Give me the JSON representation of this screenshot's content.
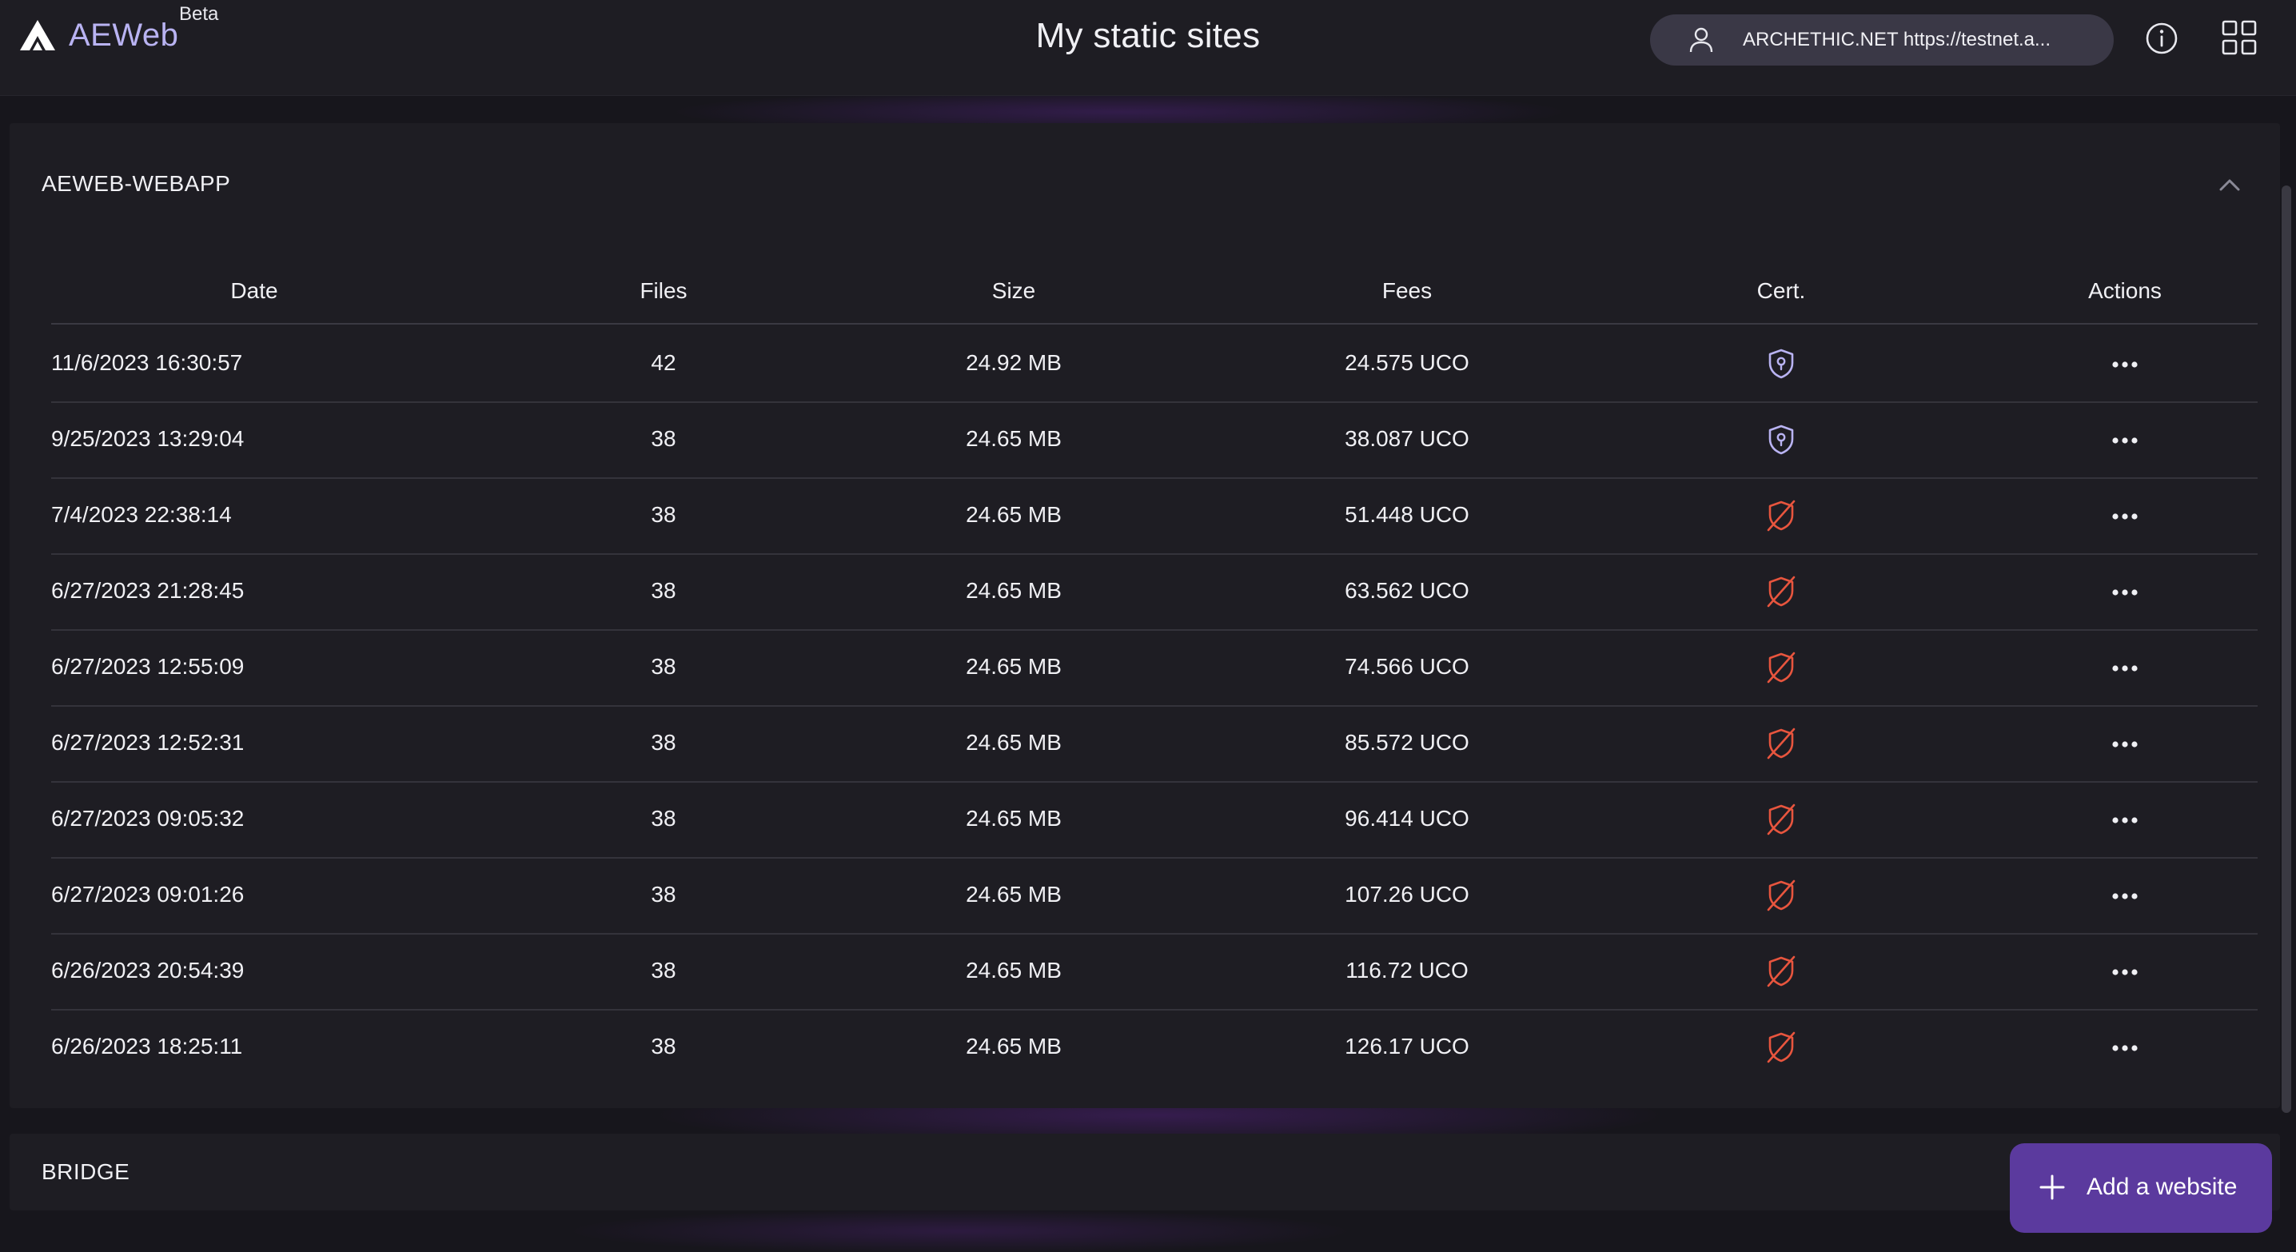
{
  "header": {
    "app_name": "AEWeb",
    "beta_label": "Beta",
    "title": "My static sites",
    "network_label": "ARCHETHIC.NET  https://testnet.a...",
    "icons": [
      "aeweb-logo-icon",
      "user-icon",
      "info-icon",
      "apps-grid-icon"
    ]
  },
  "sites": [
    {
      "name": "AEWEB-WEBAPP",
      "expanded": true,
      "columns": {
        "date": "Date",
        "files": "Files",
        "size": "Size",
        "fees": "Fees",
        "cert": "Cert.",
        "actions": "Actions"
      },
      "rows": [
        {
          "date": "11/6/2023 16:30:57",
          "files": "42",
          "size": "24.92 MB",
          "fees": "24.575 UCO",
          "cert": "certified"
        },
        {
          "date": "9/25/2023 13:29:04",
          "files": "38",
          "size": "24.65 MB",
          "fees": "38.087 UCO",
          "cert": "certified"
        },
        {
          "date": "7/4/2023 22:38:14",
          "files": "38",
          "size": "24.65 MB",
          "fees": "51.448 UCO",
          "cert": "none"
        },
        {
          "date": "6/27/2023 21:28:45",
          "files": "38",
          "size": "24.65 MB",
          "fees": "63.562 UCO",
          "cert": "none"
        },
        {
          "date": "6/27/2023 12:55:09",
          "files": "38",
          "size": "24.65 MB",
          "fees": "74.566 UCO",
          "cert": "none"
        },
        {
          "date": "6/27/2023 12:52:31",
          "files": "38",
          "size": "24.65 MB",
          "fees": "85.572 UCO",
          "cert": "none"
        },
        {
          "date": "6/27/2023 09:05:32",
          "files": "38",
          "size": "24.65 MB",
          "fees": "96.414 UCO",
          "cert": "none"
        },
        {
          "date": "6/27/2023 09:01:26",
          "files": "38",
          "size": "24.65 MB",
          "fees": "107.26 UCO",
          "cert": "none"
        },
        {
          "date": "6/26/2023 20:54:39",
          "files": "38",
          "size": "24.65 MB",
          "fees": "116.72 UCO",
          "cert": "none"
        },
        {
          "date": "6/26/2023 18:25:11",
          "files": "38",
          "size": "24.65 MB",
          "fees": "126.17 UCO",
          "cert": "none"
        }
      ]
    },
    {
      "name": "BRIDGE",
      "expanded": false
    }
  ],
  "add_button": {
    "label": "Add a website",
    "icon": "plus-icon"
  },
  "colors": {
    "accent": "#5b3a9e",
    "brand_text": "#b9b3f2",
    "cert_ok": "#b9b3f2",
    "cert_missing": "#e8553e",
    "panel_bg": "#1e1d23",
    "page_bg": "#17161c"
  }
}
